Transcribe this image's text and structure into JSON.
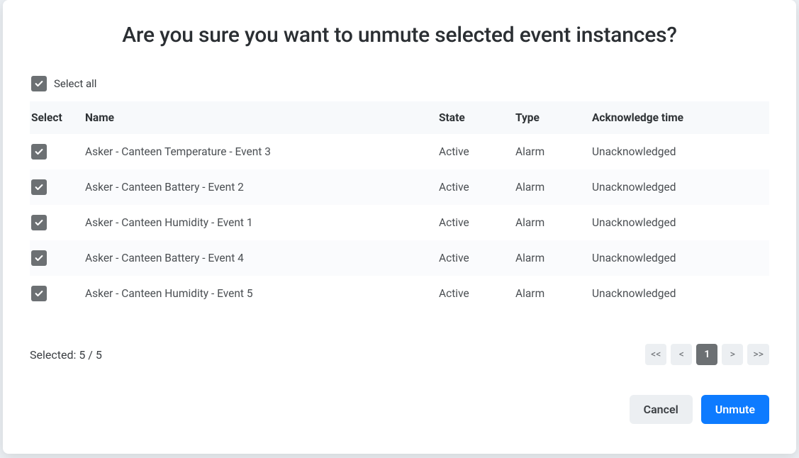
{
  "dialog": {
    "title": "Are you sure you want to unmute selected event instances?",
    "select_all_label": "Select all",
    "table": {
      "headers": {
        "select": "Select",
        "name": "Name",
        "state": "State",
        "type": "Type",
        "ack": "Acknowledge time"
      },
      "rows": [
        {
          "name": "Asker - Canteen Temperature - Event 3",
          "state": "Active",
          "type": "Alarm",
          "ack": "Unacknowledged"
        },
        {
          "name": "Asker - Canteen Battery - Event 2",
          "state": "Active",
          "type": "Alarm",
          "ack": "Unacknowledged"
        },
        {
          "name": "Asker - Canteen Humidity - Event 1",
          "state": "Active",
          "type": "Alarm",
          "ack": "Unacknowledged"
        },
        {
          "name": "Asker - Canteen Battery - Event 4",
          "state": "Active",
          "type": "Alarm",
          "ack": "Unacknowledged"
        },
        {
          "name": "Asker - Canteen Humidity - Event 5",
          "state": "Active",
          "type": "Alarm",
          "ack": "Unacknowledged"
        }
      ]
    },
    "selected_text": "Selected: 5 / 5",
    "pager": {
      "first": "<<",
      "prev": "<",
      "current_page": "1",
      "next": ">",
      "last": ">>"
    },
    "buttons": {
      "cancel": "Cancel",
      "confirm": "Unmute"
    }
  }
}
